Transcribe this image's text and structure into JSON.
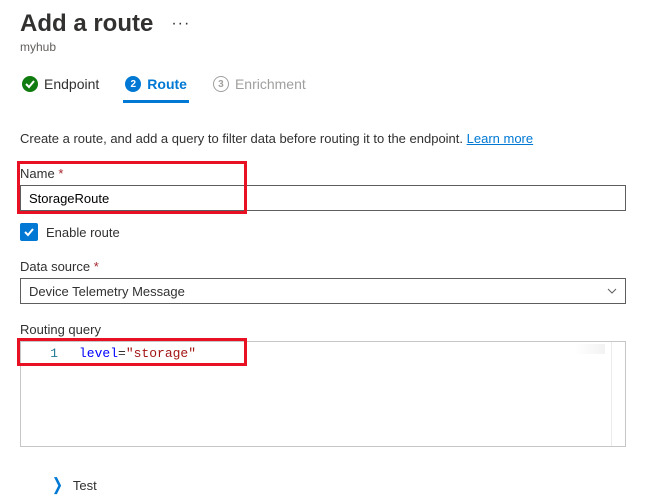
{
  "header": {
    "title": "Add a route",
    "subtitle": "myhub"
  },
  "stepper": {
    "steps": [
      {
        "num": "",
        "label": "Endpoint",
        "state": "complete"
      },
      {
        "num": "2",
        "label": "Route",
        "state": "current"
      },
      {
        "num": "3",
        "label": "Enrichment",
        "state": "upcoming"
      }
    ]
  },
  "intro": {
    "text": "Create a route, and add a query to filter data before routing it to the endpoint. ",
    "learn_more": "Learn more"
  },
  "fields": {
    "name_label": "Name",
    "name_value": "StorageRoute",
    "enable_label": "Enable route",
    "enable_checked": true,
    "data_source_label": "Data source",
    "data_source_value": "Device Telemetry Message",
    "routing_query_label": "Routing query"
  },
  "editor": {
    "line_number": "1",
    "token_key": "level",
    "token_op": "=",
    "token_str": "\"storage\""
  },
  "actions": {
    "test_label": "Test"
  }
}
